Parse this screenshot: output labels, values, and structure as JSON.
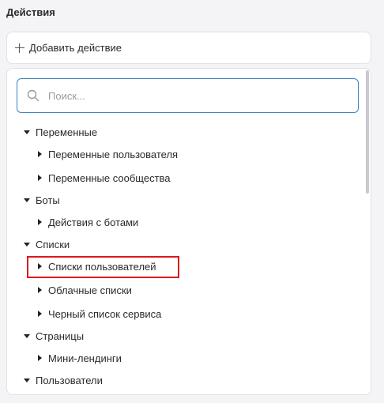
{
  "section_title": "Действия",
  "add_action_label": "Добавить действие",
  "search": {
    "placeholder": "Поиск...",
    "value": ""
  },
  "tree": {
    "groups": [
      {
        "label": "Переменные",
        "expanded": true,
        "items": [
          "Переменные пользователя",
          "Переменные сообщества"
        ]
      },
      {
        "label": "Боты",
        "expanded": true,
        "items": [
          "Действия с ботами"
        ]
      },
      {
        "label": "Списки",
        "expanded": true,
        "items": [
          "Списки пользователей",
          "Облачные списки",
          "Черный список сервиса"
        ]
      },
      {
        "label": "Страницы",
        "expanded": true,
        "items": [
          "Мини-лендинги"
        ]
      },
      {
        "label": "Пользователи",
        "expanded": true,
        "items": []
      }
    ],
    "highlighted_item": "Списки пользователей"
  },
  "colors": {
    "search_border": "#3b82c4",
    "highlight_border": "#e0161d",
    "panel_background": "#ffffff",
    "page_background": "#f4f4f6"
  }
}
